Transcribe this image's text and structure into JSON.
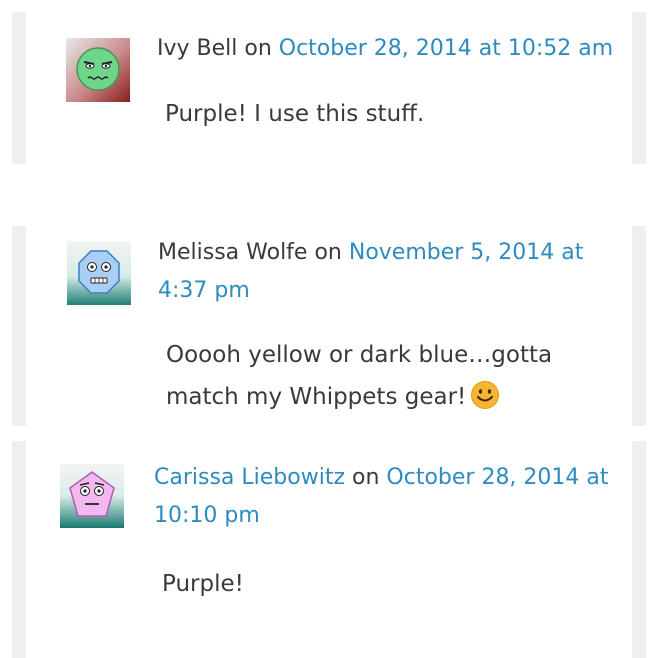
{
  "comments": [
    {
      "author": "Ivy Bell",
      "separator": " on ",
      "date": "October 28, 2014 at 10:52 am",
      "text": "Purple! I use this stuff.",
      "avatar": "green-face-avatar-icon"
    },
    {
      "author": "Melissa Wolfe",
      "separator": " on ",
      "date": "November 5, 2014 at 4:37 pm",
      "text": "Ooooh yellow or dark blue…gotta match my Whippets gear!",
      "avatar": "blue-octagon-face-avatar-icon",
      "emoji": "smiley-emoji-icon"
    },
    {
      "author": "Carissa Liebowitz",
      "separator": " on ",
      "date": "October 28, 2014 at 10:10 pm",
      "text": "Purple!",
      "avatar": "pink-pentagon-face-avatar-icon"
    }
  ],
  "colors": {
    "link": "#2e8bc0",
    "text": "#3a3a3a",
    "border": "#efefef"
  }
}
